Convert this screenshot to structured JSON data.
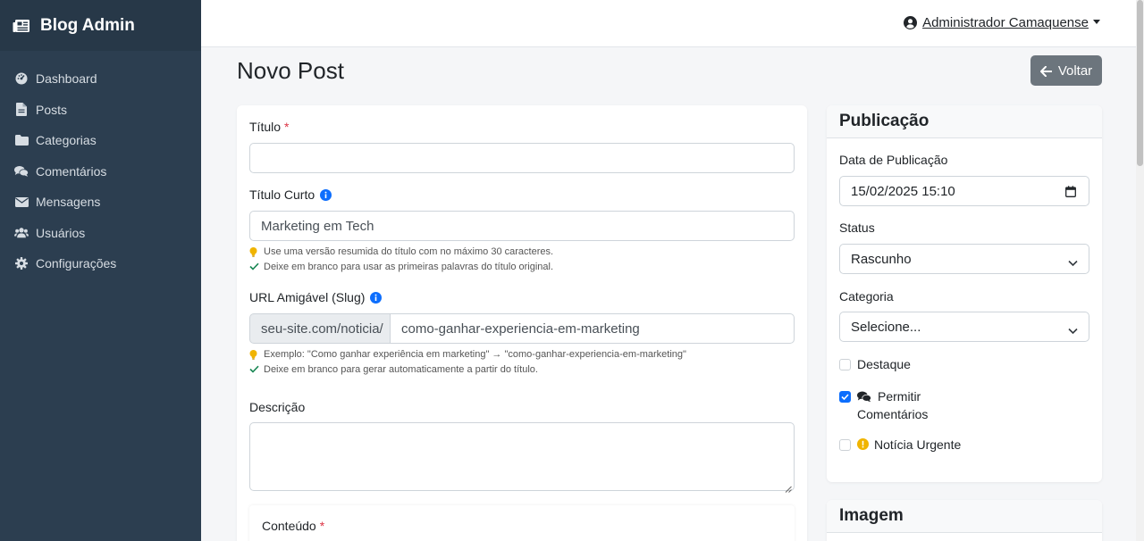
{
  "sidebar": {
    "brand": "Blog Admin",
    "items": [
      {
        "label": "Dashboard",
        "icon": "dashboard-icon"
      },
      {
        "label": "Posts",
        "icon": "file-icon"
      },
      {
        "label": "Categorias",
        "icon": "folder-icon"
      },
      {
        "label": "Comentários",
        "icon": "comments-icon"
      },
      {
        "label": "Mensagens",
        "icon": "envelope-icon"
      },
      {
        "label": "Usuários",
        "icon": "users-icon"
      },
      {
        "label": "Configurações",
        "icon": "gear-icon"
      }
    ]
  },
  "topbar": {
    "user_name": "Administrador Camaquense"
  },
  "page": {
    "title": "Novo Post",
    "back_label": "Voltar"
  },
  "form": {
    "titulo": {
      "label": "Título",
      "required_mark": "*",
      "value": ""
    },
    "titulo_curto": {
      "label": "Título Curto",
      "value": "Marketing em Tech",
      "hint1": "Use uma versão resumida do título com no máximo 30 caracteres.",
      "hint2": "Deixe em branco para usar as primeiras palavras do título original."
    },
    "slug": {
      "label": "URL Amigável (Slug)",
      "prefix": "seu-site.com/noticia/",
      "value": "como-ganhar-experiencia-em-marketing",
      "hint1": "Exemplo: \"Como ganhar experiência em marketing\" → \"como-ganhar-experiencia-em-marketing\"",
      "hint2": "Deixe em branco para gerar automaticamente a partir do título."
    },
    "descricao": {
      "label": "Descrição",
      "value": ""
    },
    "conteudo": {
      "label": "Conteúdo",
      "required_mark": "*"
    }
  },
  "publicacao": {
    "title": "Publicação",
    "data_label": "Data de Publicação",
    "data_value": "15/02/2025 15:10",
    "status_label": "Status",
    "status_value": "Rascunho",
    "categoria_label": "Categoria",
    "categoria_value": "Selecione...",
    "destaque_label": "Destaque",
    "destaque_checked": false,
    "comentarios_label1": "Permitir",
    "comentarios_label2": "Comentários",
    "comentarios_checked": true,
    "urgente_label": "Notícia Urgente",
    "urgente_checked": false
  },
  "imagem": {
    "title": "Imagem"
  },
  "colors": {
    "sidebar": "#2c3e50",
    "primary": "#0d6efd",
    "secondary": "#6c757d",
    "required": "#dc3545",
    "hint_bulb": "#f0b400",
    "hint_check": "#198754"
  }
}
